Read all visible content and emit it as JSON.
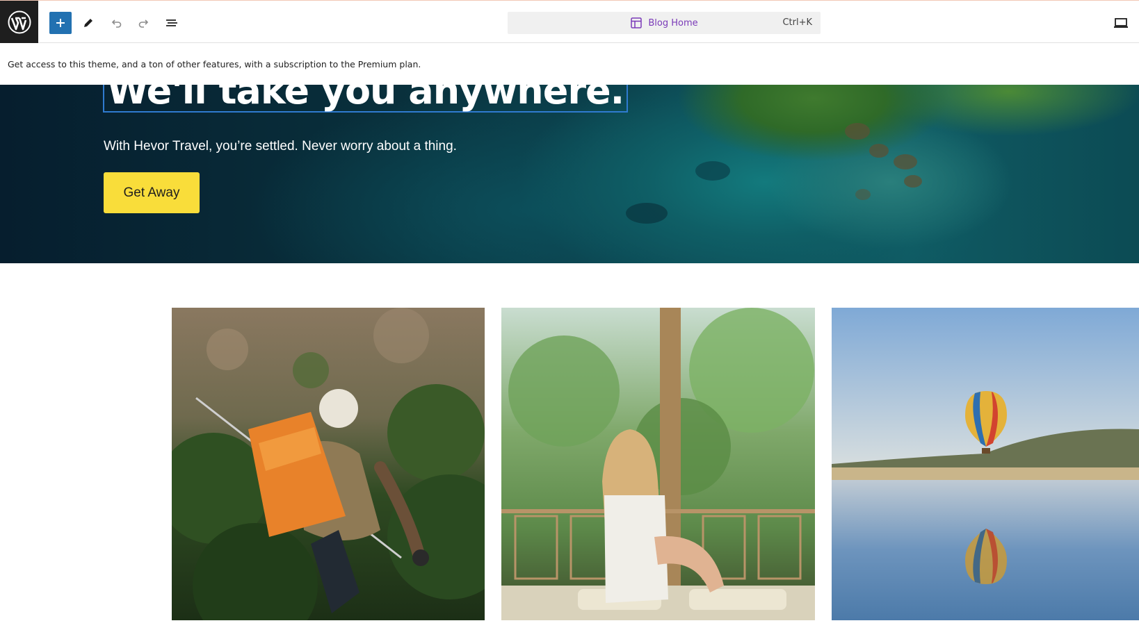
{
  "toolbar": {
    "site_icon": "wordpress-logo-icon",
    "add_button": "plus-icon",
    "tools": [
      "pencil-icon",
      "undo-icon",
      "redo-icon",
      "list-view-icon"
    ],
    "command_bar": {
      "icon": "layout-template-icon",
      "title": "Blog Home",
      "shortcut": "Ctrl+K"
    },
    "device_preview_icon": "desktop-icon"
  },
  "notice": {
    "text": "Get access to this theme, and a ton of other features, with a subscription to the Premium plan."
  },
  "hero": {
    "heading": "We'll take you anywhere.",
    "subheading": "With Hevor Travel, you’re settled. Never worry about a thing.",
    "cta_label": "Get Away",
    "cta_color": "#f9dd3a"
  },
  "gallery": {
    "images": [
      "hiker-with-orange-backpack",
      "woman-looking-at-palm-trees",
      "hot-air-balloon-over-lake"
    ]
  },
  "colors": {
    "accent": "#2271b1",
    "brand_dark": "#1e1e1e",
    "template_title": "#7a3ab8"
  }
}
